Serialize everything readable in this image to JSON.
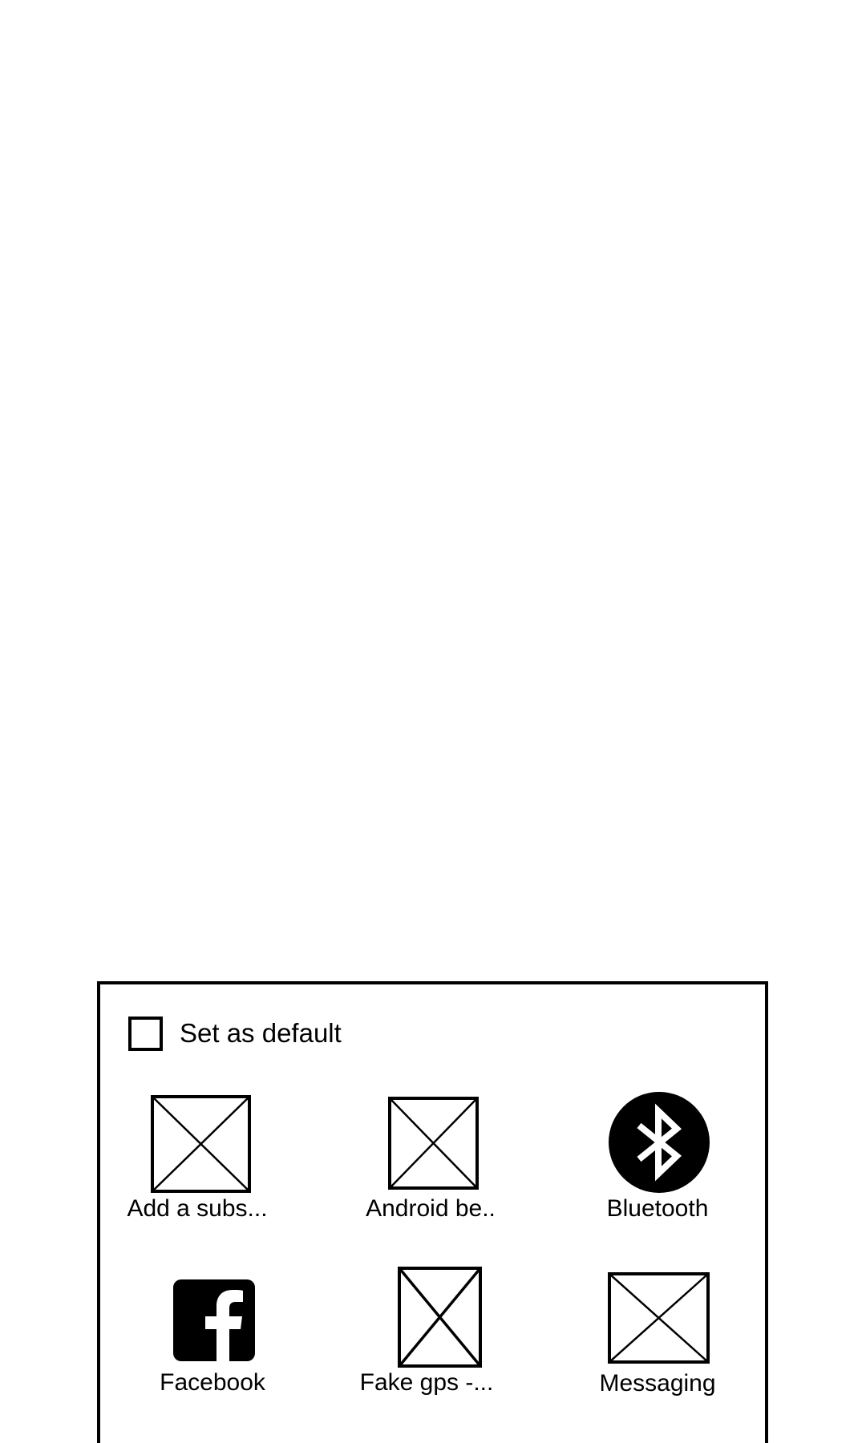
{
  "dialog": {
    "set_default_label": "Set as default",
    "apps": [
      {
        "label": "Add a subs...",
        "icon": "placeholder-icon"
      },
      {
        "label": "Android be..",
        "icon": "placeholder-icon"
      },
      {
        "label": "Bluetooth",
        "icon": "bluetooth-icon"
      },
      {
        "label": "Facebook",
        "icon": "facebook-icon"
      },
      {
        "label": "Fake gps -...",
        "icon": "placeholder-icon"
      },
      {
        "label": "Messaging",
        "icon": "placeholder-icon"
      }
    ]
  }
}
